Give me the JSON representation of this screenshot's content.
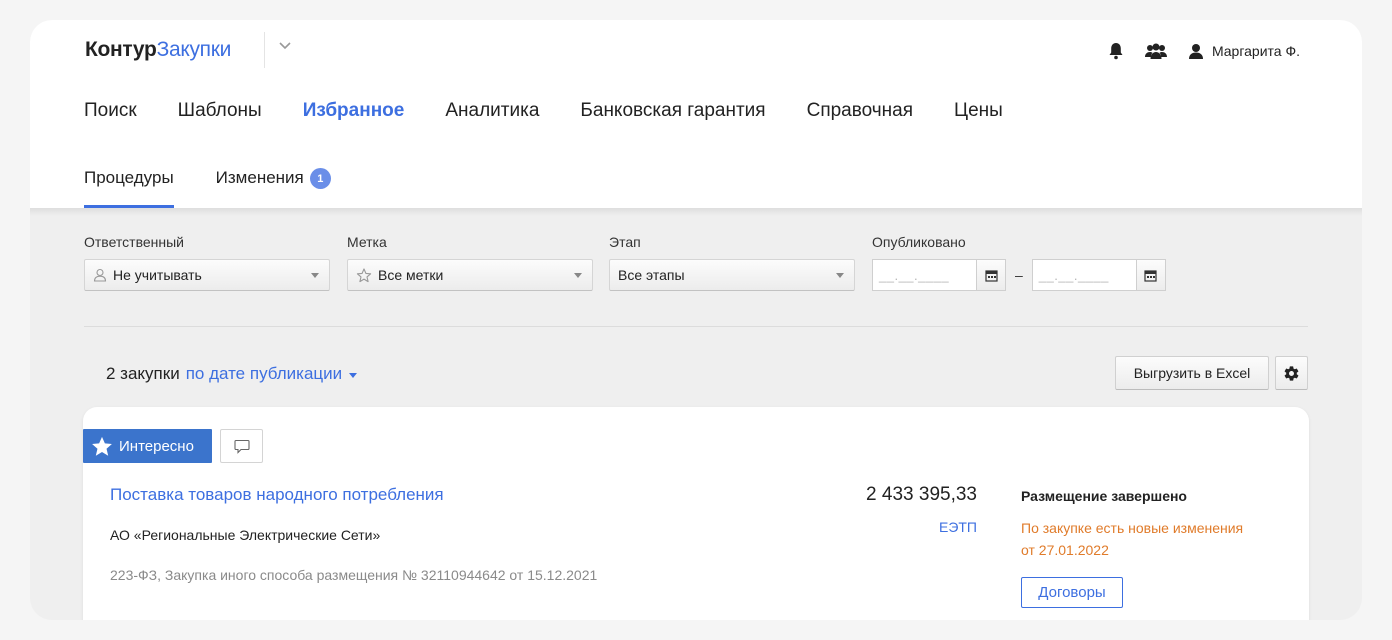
{
  "logo": {
    "part1": "Контур",
    "part2": "Закупки"
  },
  "header": {
    "user_name": "Маргарита Ф."
  },
  "main_nav": [
    {
      "label": "Поиск",
      "active": false
    },
    {
      "label": "Шаблоны",
      "active": false
    },
    {
      "label": "Избранное",
      "active": true
    },
    {
      "label": "Аналитика",
      "active": false
    },
    {
      "label": "Банковская гарантия",
      "active": false
    },
    {
      "label": "Справочная",
      "active": false
    },
    {
      "label": "Цены",
      "active": false
    }
  ],
  "sub_nav": {
    "procedures": "Процедуры",
    "changes": "Изменения",
    "changes_count": "1"
  },
  "filters": {
    "responsible": {
      "label": "Ответственный",
      "value": "Не учитывать"
    },
    "tag": {
      "label": "Метка",
      "value": "Все метки"
    },
    "stage": {
      "label": "Этап",
      "value": "Все этапы"
    },
    "published": {
      "label": "Опубликовано",
      "from_placeholder": "__.__.____",
      "to_placeholder": "__.__.____",
      "separator": "–"
    }
  },
  "results": {
    "count_text": "2 закупки",
    "sort_text": "по дате публикации",
    "export_label": "Выгрузить в Excel"
  },
  "procurement": {
    "favorite_label": "Интересно",
    "title": "Поставка товаров народного потребления",
    "organization": "АО «Региональные Электрические Сети»",
    "meta": "223-ФЗ, Закупка иного способа размещения № 32110944642 от 15.12.2021",
    "price": "2 433 395,33",
    "platform": "ЕЭТП",
    "status": "Размещение завершено",
    "change_notice_line1": "По закупке есть новые изменения",
    "change_notice_line2": "от 27.01.2022",
    "contracts_label": "Договоры"
  },
  "colors": {
    "accent": "#3d6fe0",
    "favorite": "#3b74cc",
    "warning": "#e07b2a"
  }
}
